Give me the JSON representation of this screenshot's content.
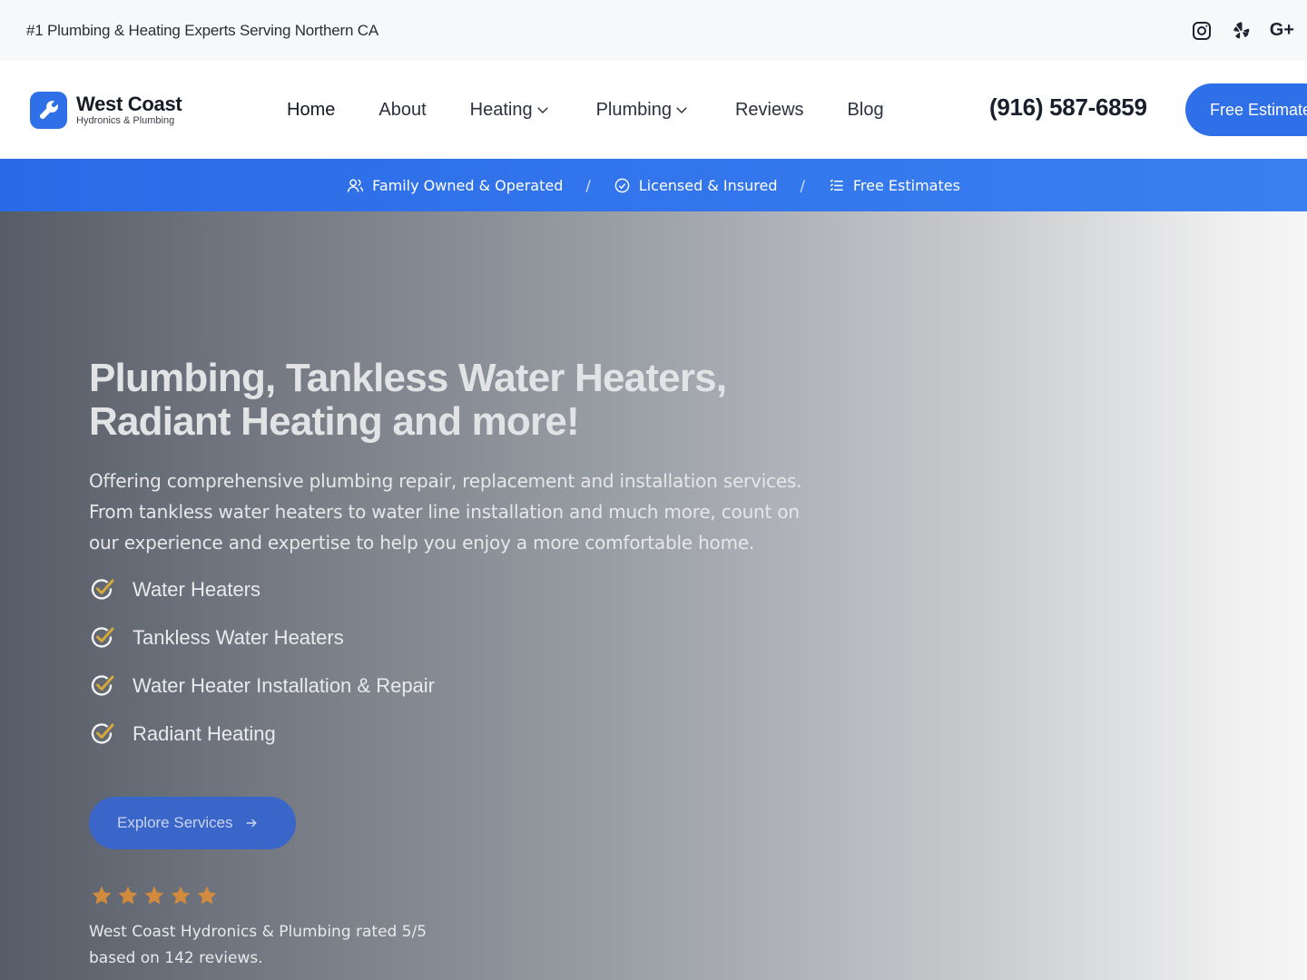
{
  "topbar": {
    "tagline": "#1 Plumbing & Heating Experts Serving Northern CA",
    "socials": [
      {
        "icon": "instagram-icon"
      },
      {
        "icon": "yelp-icon"
      },
      {
        "icon": "google-plus-icon",
        "label": "G+"
      }
    ]
  },
  "header": {
    "logo_title": "West Coast",
    "logo_subtitle": "Hydronics & Plumbing",
    "nav": [
      {
        "label": "Home",
        "active": true
      },
      {
        "label": "About"
      },
      {
        "label": "Heating",
        "dropdown": true
      },
      {
        "label": "Plumbing",
        "dropdown": true
      },
      {
        "label": "Reviews"
      },
      {
        "label": "Blog"
      }
    ],
    "phone": "(916) 587-6859",
    "cta_label": "Free Estimate"
  },
  "trustbar": {
    "items": [
      {
        "icon": "people-icon",
        "label": "Family Owned & Operated"
      },
      {
        "icon": "badge-check-icon",
        "label": "Licensed & Insured"
      },
      {
        "icon": "list-icon",
        "label": "Free Estimates"
      }
    ],
    "separator": "/"
  },
  "hero": {
    "title_line1": "Plumbing, Tankless Water Heaters,",
    "title_line2": "Radiant Heating and more!",
    "description": "Offering comprehensive plumbing repair, replacement and installation services. From tankless water heaters to water line installation and much more, count on our experience and expertise to help you enjoy a more comfortable home.",
    "features": [
      "Water Heaters",
      "Tankless Water Heaters",
      "Water Heater Installation & Repair",
      "Radiant Heating"
    ],
    "button_label": "Explore Services",
    "rating_stars": 5,
    "rating_line1": "West Coast Hydronics & Plumbing rated 5/5",
    "rating_line2": "based on 142 reviews."
  },
  "colors": {
    "brand_blue": "#2f6fe8",
    "check_gold": "#d4a93a",
    "star_orange": "#d28a3c"
  }
}
